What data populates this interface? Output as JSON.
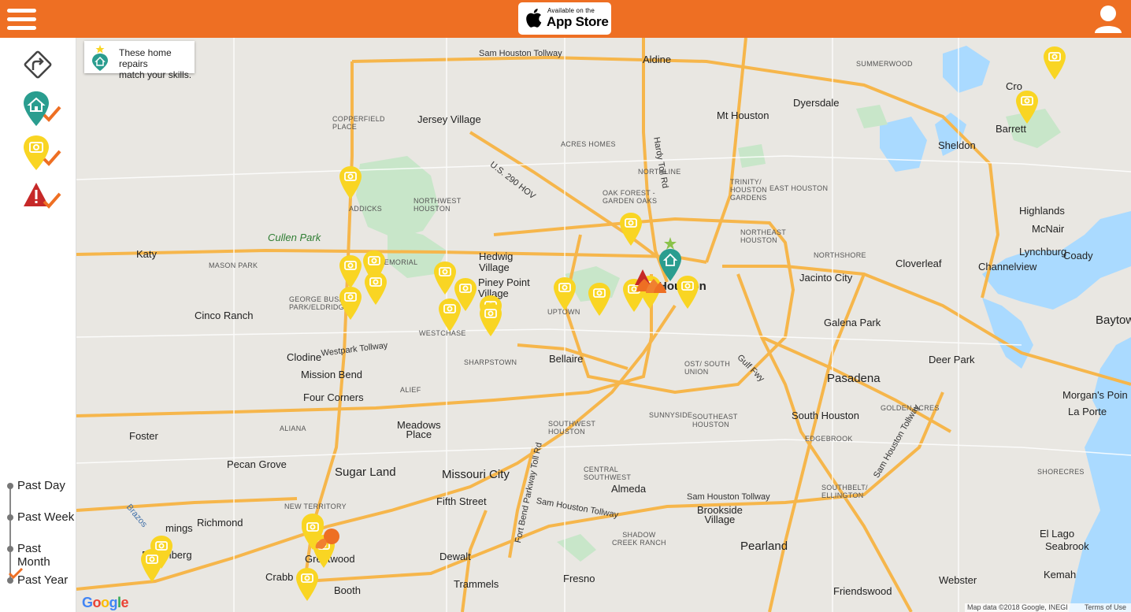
{
  "header": {
    "appstore_small": "Available on the",
    "appstore_big": "App Store"
  },
  "legend": {
    "line1": "These home repairs",
    "line2": "match your skills."
  },
  "timeline": [
    "Past Day",
    "Past Week",
    "Past Month",
    "Past Year"
  ],
  "timeline_selected": "Past Year",
  "map_labels": {
    "sam_houston_tollway_n": "Sam Houston Tollway",
    "aldine": "Aldine",
    "summerwood": "SUMMERWOOD",
    "crosby": "Cro",
    "copperfield": "COPPERFIELD\nPLACE",
    "jersey_village": "Jersey Village",
    "dyersdale": "Dyersdale",
    "mt_houston": "Mt Houston",
    "hardy_toll": "Hardy Toll Rd",
    "barrett": "Barrett",
    "sheldon": "Sheldon",
    "acres_homes": "ACRES HOMES",
    "us290hov": "U.S. 290 HOV",
    "northline": "NORTHLINE",
    "trinity_gardens": "TRINITY/\nHOUSTON\nGARDENS",
    "east_houston": "EAST HOUSTON",
    "oak_forest": "OAK FOREST -\nGARDEN OAKS",
    "addicks": "ADDICKS",
    "northwest_houston": "NORTHWEST\nHOUSTON",
    "highlands": "Highlands",
    "mcnair": "McNair",
    "northeast_houston": "NORTHEAST\nHOUSTON",
    "cullen_park": "Cullen Park",
    "lynchburg": "Lynchburg",
    "katy": "Katy",
    "mason_park": "MASON PARK",
    "memorial": "MEMORIAL",
    "hedwig": "Hedwig\nVillage",
    "northshore": "NORTHSHORE",
    "cloverleaf": "Cloverleaf",
    "coady": "Coady",
    "channelview": "Channelview",
    "jacinto_city": "Jacinto City",
    "piney_point": "Piney Point\nVillage",
    "houston": "Houston",
    "george_bush": "GEORGE BUSH\nPARK/ELDRIDGE",
    "uptown": "UPTOWN",
    "cinco_ranch": "Cinco Ranch",
    "galena_park": "Galena Park",
    "baytown": "Baytow",
    "westchase": "WESTCHASE",
    "westpark": "Westpark Tollway",
    "clodine": "Clodine",
    "bellaire": "Bellaire",
    "sharpstown": "SHARPSTOWN",
    "ost": "OST/ SOUTH\nUNION",
    "deer_park": "Deer Park",
    "mission_bend": "Mission Bend",
    "gulf_fwy": "Gulf Fwy",
    "pasadena": "Pasadena",
    "alief": "ALIEF",
    "four_corners": "Four Corners",
    "morgans_point": "Morgan's Poin",
    "la_porte": "La Porte",
    "sunnyside": "SUNNYSIDE",
    "southeast_houston": "SOUTHEAST\nHOUSTON",
    "golden_acres": "GOLDEN ACRES",
    "south_houston": "South Houston",
    "aliana": "ALIANA",
    "meadows_place": "Meadows\nPlace",
    "southwest_houston": "SOUTHWEST\nHOUSTON",
    "edgebrook": "EDGEBROOK",
    "foster": "Foster",
    "sam_houston_tollway_se": "Sam Houston Tollway",
    "pecan_grove": "Pecan Grove",
    "central_southwest": "CENTRAL\nSOUTHWEST",
    "shorecres": "SHORECRES",
    "sugar_land": "Sugar Land",
    "missouri_city": "Missouri City",
    "fort_bend_toll": "Fort Bend Parkway Toll Rd",
    "richmond": "Richmond",
    "new_territory": "NEW TERRITORY",
    "fifth_street": "Fifth Street",
    "alameda": "Almeda",
    "southbelt": "SOUTHBELT/\nELLINGTON",
    "brookside": "Brookside\nVillage",
    "sam_houston_tollway_s": "Sam Houston Tollway",
    "sam_houston_tollway_sw": "Sam Houston Tollway",
    "el_lago": "El Lago",
    "seabrook": "Seabrook",
    "kemah": "Kemah",
    "rosenberg": "Rosenberg",
    "cummings": "mings",
    "shadow_creek": "SHADOW\nCREEK RANCH",
    "pearland": "Pearland",
    "greatwood": "Greatwood",
    "dewalt": "Dewalt",
    "crabb": "Crabb",
    "trammels": "Trammels",
    "fresno": "Fresno",
    "booth": "Booth",
    "friendswood": "Friendswood",
    "webster": "Webster",
    "brazos": "Brazos"
  },
  "attribution": {
    "data": "Map data ©2018 Google, INEGI",
    "terms": "Terms of Use"
  },
  "google_logo": "Google",
  "colors": {
    "brand_orange": "#ee6f23",
    "camera_pin": "#f9d523",
    "skill_pin": "#2a9d8f",
    "alert": "#c62828"
  }
}
